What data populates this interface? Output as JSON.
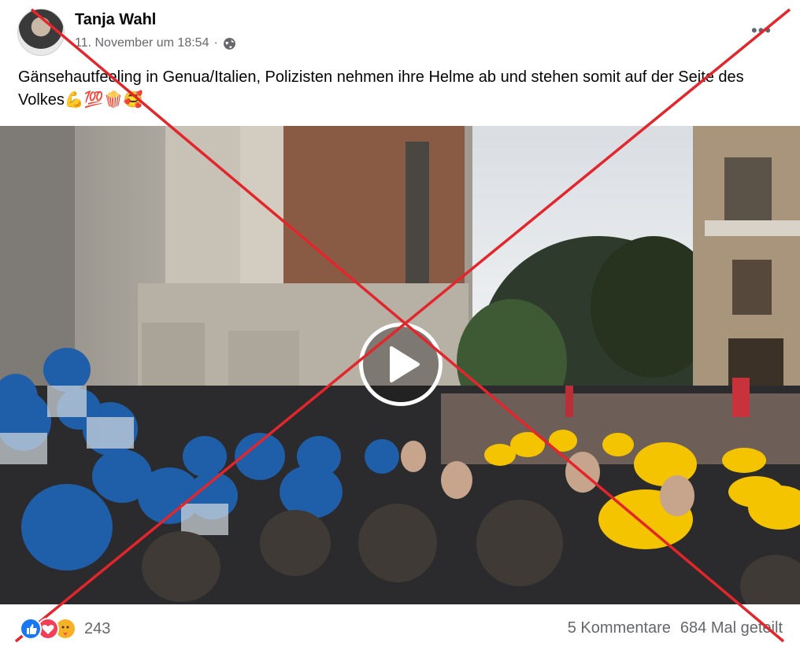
{
  "post": {
    "author": "Tanja Wahl",
    "timestamp": "11. November um 18:54",
    "separator": "·",
    "privacy_icon": "globe-icon",
    "more_icon": "more-options-icon",
    "more_label": "•••",
    "text": "Gänsehautfeeling in Genua/Italien, Polizisten nehmen ihre Helme ab und stehen somit auf der Seite des Volkes💪💯🍿🥰"
  },
  "video": {
    "play_icon": "play-icon"
  },
  "stats": {
    "reaction_icons": [
      "like-icon",
      "love-icon",
      "care-icon"
    ],
    "reaction_count": "243",
    "comments": "5 Kommentare",
    "shares": "684 Mal geteilt"
  },
  "colors": {
    "cross": "#e3262c",
    "play_ring": "#ffffff",
    "meta_text": "#65676b",
    "police_helmet": "#1f5ea8",
    "hard_hat": "#f5c400"
  }
}
